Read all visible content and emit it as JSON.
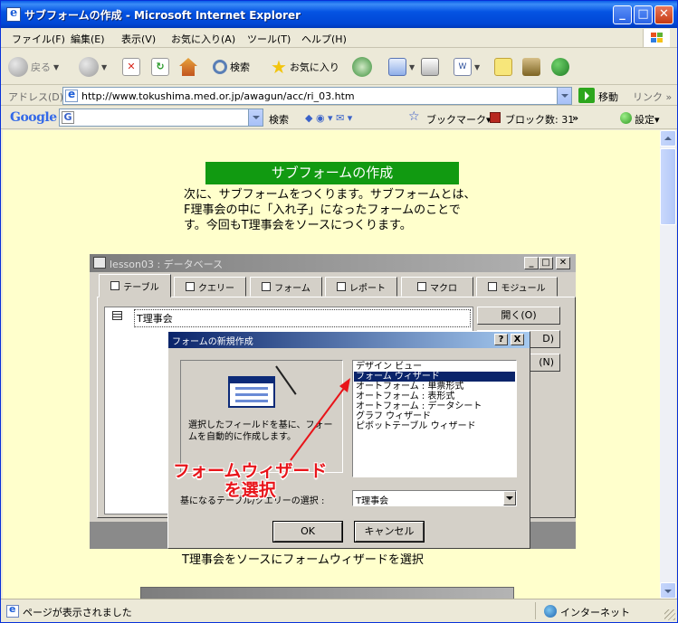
{
  "window": {
    "title": "サブフォームの作成 - Microsoft Internet Explorer",
    "minimize_label": "_",
    "maximize_label": "□",
    "close_label": "✕"
  },
  "menubar": {
    "items": [
      "ファイル(F)",
      "編集(E)",
      "表示(V)",
      "お気に入り(A)",
      "ツール(T)",
      "ヘルプ(H)"
    ]
  },
  "toolbar": {
    "back_label": "戻る",
    "search_label": "検索",
    "favorites_label": "お気に入り"
  },
  "addressbar": {
    "label": "アドレス(D)",
    "url": "http://www.tokushima.med.or.jp/awagun/acc/ri_03.htm",
    "go_label": "移動",
    "links_label": "リンク »"
  },
  "googlebar": {
    "logo": "Google",
    "search_label": "検索",
    "bookmarks_label": "ブックマーク▾",
    "popup_block_label": "ブロック数: 31",
    "more_label": "»",
    "settings_label": "設定▾"
  },
  "page": {
    "heading": "サブフォームの作成",
    "intro": "次に、サブフォームをつくります。サブフォームとは、F理事会の中に「入れ子」になったフォームのことです。今回もT理事会をソースにつくります。",
    "caption1": "T理事会をソースにフォームウィザードを選択"
  },
  "screenshot": {
    "db_title": "lesson03 : データベース",
    "tabs": [
      "テーブル",
      "クエリー",
      "フォーム",
      "レポート",
      "マクロ",
      "モジュール"
    ],
    "table_item": "T理事会",
    "side_buttons": [
      "開く(O)",
      "D)",
      "(N)"
    ],
    "dialog": {
      "title": "フォームの新規作成",
      "help_label": "?",
      "close_label": "X",
      "description": "選択したフィールドを基に、フォームを自動的に作成します。",
      "wizards": [
        "デザイン ビュー",
        "フォーム ウィザード",
        "オートフォーム : 単票形式",
        "オートフォーム : 表形式",
        "オートフォーム : データシート",
        "グラフ ウィザード",
        "ピボットテーブル ウィザード"
      ],
      "selected_index": 1,
      "base_label": "基になるテーブル/クエリーの選択 :",
      "base_value": "T理事会",
      "ok_label": "OK",
      "cancel_label": "キャンセル"
    },
    "annotation": {
      "line1": "フォームウィザード",
      "line2": "を選択",
      "color": "#e8141a"
    }
  },
  "statusbar": {
    "text": "ページが表示されました",
    "zone": "インターネット"
  }
}
